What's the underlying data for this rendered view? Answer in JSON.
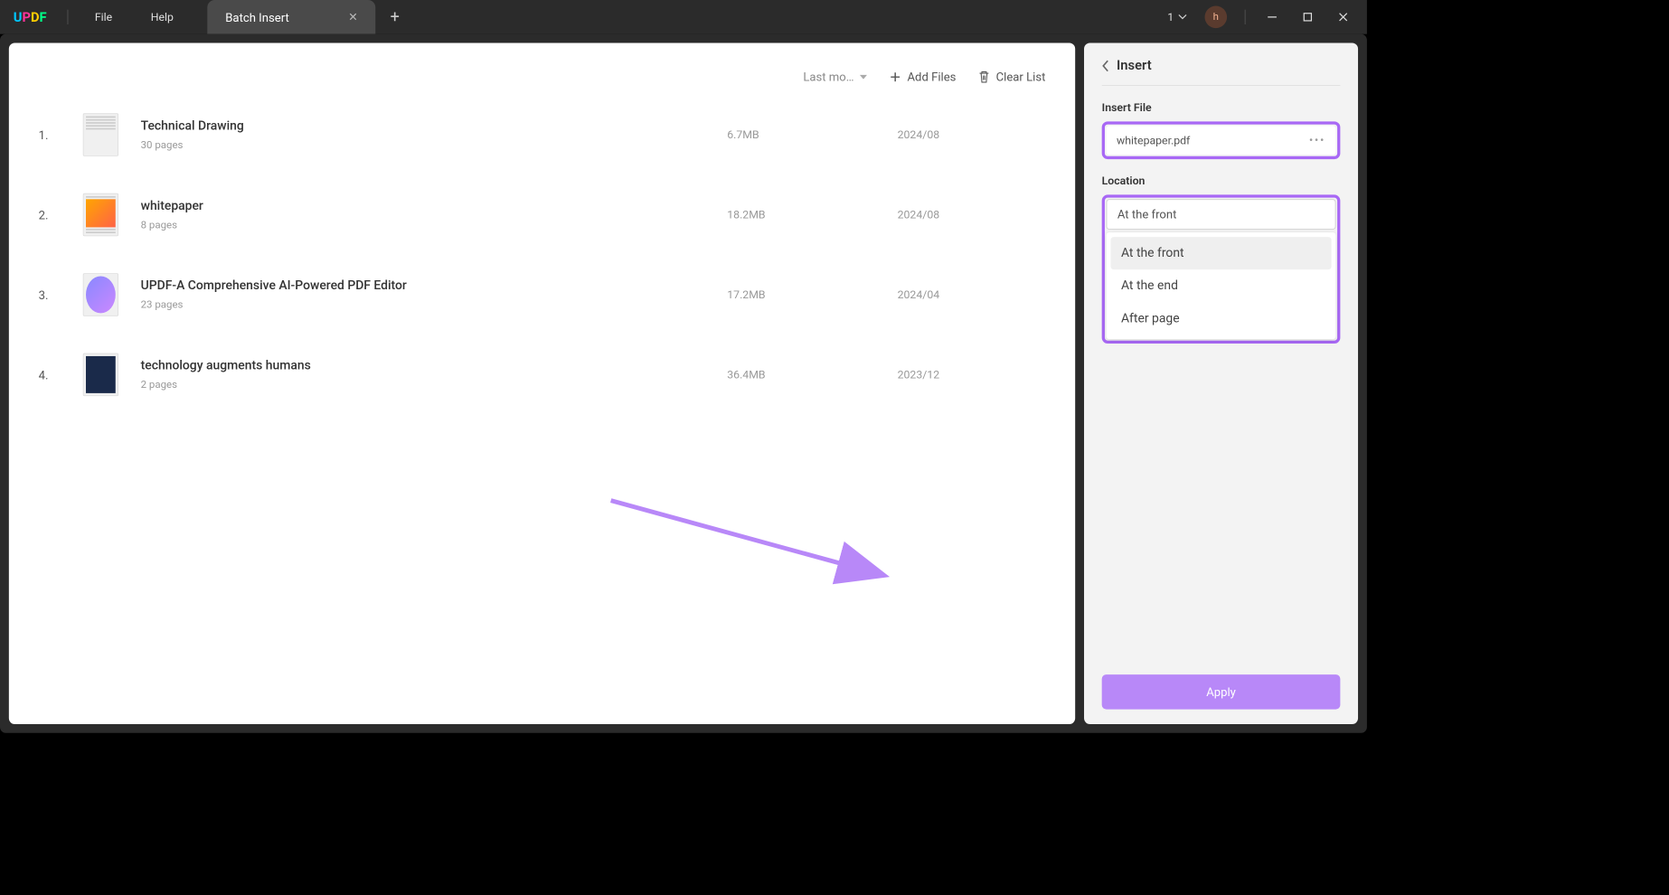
{
  "titlebar": {
    "menu_file": "File",
    "menu_help": "Help",
    "tab_title": "Batch Insert",
    "doc_count": "1",
    "avatar_letter": "h"
  },
  "toolbar": {
    "sort_label": "Last mo…",
    "add_files": "Add Files",
    "clear_list": "Clear List"
  },
  "files": [
    {
      "num": "1.",
      "name": "Technical Drawing",
      "pages": "30 pages",
      "size": "6.7MB",
      "date": "2024/08",
      "thumb": "lines"
    },
    {
      "num": "2.",
      "name": "whitepaper",
      "pages": "8 pages",
      "size": "18.2MB",
      "date": "2024/08",
      "thumb": "img"
    },
    {
      "num": "3.",
      "name": "UPDF-A Comprehensive AI-Powered PDF Editor",
      "pages": "23 pages",
      "size": "17.2MB",
      "date": "2024/04",
      "thumb": "blue"
    },
    {
      "num": "4.",
      "name": "technology augments humans",
      "pages": "2 pages",
      "size": "36.4MB",
      "date": "2023/12",
      "thumb": "dark"
    }
  ],
  "panel": {
    "title": "Insert",
    "insert_file_label": "Insert File",
    "insert_file_value": "whitepaper.pdf",
    "location_label": "Location",
    "location_value": "At the front",
    "options": [
      "At the front",
      "At the end",
      "After page"
    ],
    "apply": "Apply"
  },
  "annotation": {
    "arrow_color": "#b888f8",
    "highlight_color": "#a868f5"
  }
}
